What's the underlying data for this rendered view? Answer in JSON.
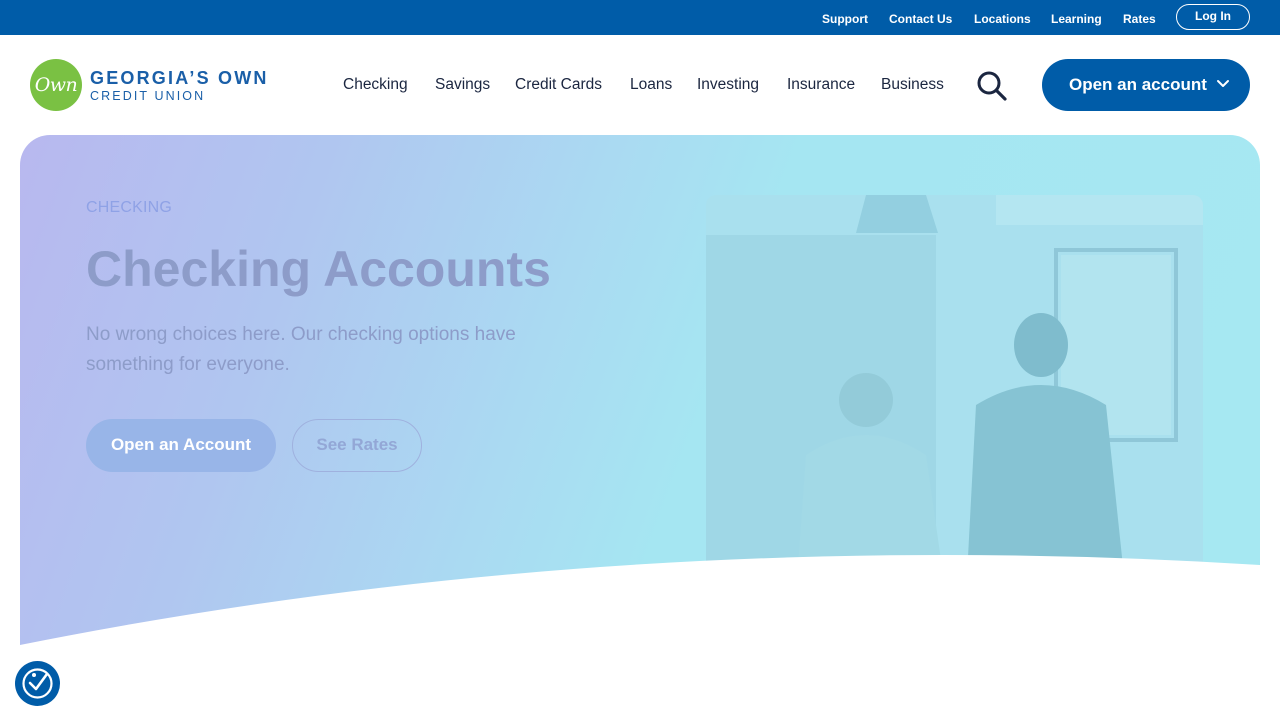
{
  "utility_nav": {
    "links": [
      "Support",
      "Contact Us",
      "Locations",
      "Learning",
      "Rates"
    ],
    "login_label": "Log In"
  },
  "brand": {
    "logo_mark": "Own",
    "name": "GEORGIA’S OWN",
    "subtitle": "CREDIT UNION"
  },
  "main_nav": {
    "items": [
      "Checking",
      "Savings",
      "Credit Cards",
      "Loans",
      "Investing",
      "Insurance",
      "Business"
    ],
    "search_icon": "search-icon",
    "cta_label": "Open an account",
    "cta_icon": "chevron-down-icon"
  },
  "hero": {
    "eyebrow": "CHECKING",
    "title": "Checking Accounts",
    "description": "No wrong choices here. Our checking options have something for everyone.",
    "primary_button": "Open an Account",
    "secondary_button": "See Rates"
  },
  "accessibility": {
    "icon": "accessibility-icon"
  },
  "colors": {
    "brand_blue": "#005ca8",
    "brand_green": "#7ac143",
    "nav_text": "#1b2640"
  }
}
